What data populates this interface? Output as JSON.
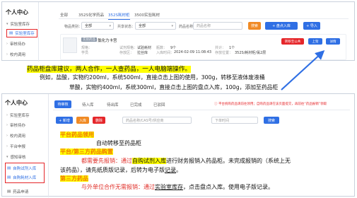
{
  "top": {
    "sidebar": {
      "title": "个人中心",
      "items": [
        {
          "label": "实验室库存",
          "expanded": true
        },
        {
          "label": "实验室库存",
          "selected": true
        },
        {
          "label": "审核待办"
        },
        {
          "label": "校内调用"
        }
      ]
    },
    "tabs": [
      "全部",
      "352S化学药品",
      "352S耗材柜",
      "3500实验耗材"
    ],
    "active_tab": 2,
    "filters": {
      "labels": [
        "物品类别：",
        "共享状态：",
        "药品名称"
      ],
      "selects": [
        "全部",
        "全部"
      ],
      "placeholder": "药品名称"
    },
    "buttons": {
      "search": "搜索",
      "stocktake": "+ 盘点入库",
      "import": "+ 导入"
    },
    "item": {
      "tag": "实验药品",
      "name": "氯化力卡宫",
      "labels": [
        "规格：",
        "试剂规格：",
        "学员",
        "存放区：",
        "规格：",
        "入库时间：",
        "瓶数：",
        "共计：",
        "存放位置："
      ],
      "values": [
        "",
        "试验耗材",
        "",
        "拉丝库",
        "",
        "2024-02-09 11:08:43",
        "9个",
        "1个",
        "352S/耗材柜/氯2层"
      ],
      "actions": [
        "转移至公共",
        "上架",
        "详情"
      ]
    }
  },
  "note": {
    "line1": {
      "hl": "药品柜盘库建议，两人合作，一人查药品，一人电脑端操作。"
    },
    "line2": "例如，盐酸，实物约200ml，系统500ml，直接点击上图的使用，300g，转移至液体废液桶",
    "line3": "草酸，实物约400ml，系统300ml，直接点击上图的盘点入库，100g，添加至药品柜"
  },
  "bottom": {
    "sidebar": {
      "title": "个人中心",
      "items": [
        {
          "label": "实验室库存"
        },
        {
          "label": "审核待办"
        },
        {
          "label": "校内调用"
        },
        {
          "label": "平台申报"
        },
        {
          "label": "感知审核"
        },
        {
          "label": "自购试剂入库",
          "boxed": true
        },
        {
          "label": "自购耗材入库",
          "boxed": true
        },
        {
          "label": "药品申请"
        }
      ]
    },
    "tabs": [
      "待审核",
      "待入库",
      "待出库",
      "已完成",
      "已驳回"
    ],
    "warning": "平台统购药品请前往领用；自购药品请在该页面提交，再前往“药品报销”领取",
    "buttons": {
      "add": "+ 新增",
      "b2": "入库",
      "b3": "删除",
      "search": "搜索"
    },
    "filters": {
      "placeholder1": "药品名称/CAS号/供应商",
      "placeholder2": "下单时间"
    },
    "note": {
      "h1": "平台药品领用",
      "t1": "自动转移至药品柜",
      "h2": "平台/第三方药品购置",
      "t2a_pre": "都需要先报销：通过",
      "t2a_hl": "自购试剂入库",
      "t2a_post": "进行财务报销入药品柜。未完成报销的（系统上无",
      "t2b_pre": "该药品），请先纸质版记录，后转为电子版",
      "t2b_ul": "记录",
      "t2b_post": "。",
      "h3": "第三方药品",
      "t3_red": "与外单位合作无需报销：通过",
      "t3_ul": "实验室库存",
      "t3_post": "，点击盘点入库。使用电子版记录。"
    }
  },
  "colors": {
    "primary": "#2f6fe4",
    "orange": "#f08a24",
    "danger": "#e5262a",
    "highlight": "#ffff00"
  }
}
